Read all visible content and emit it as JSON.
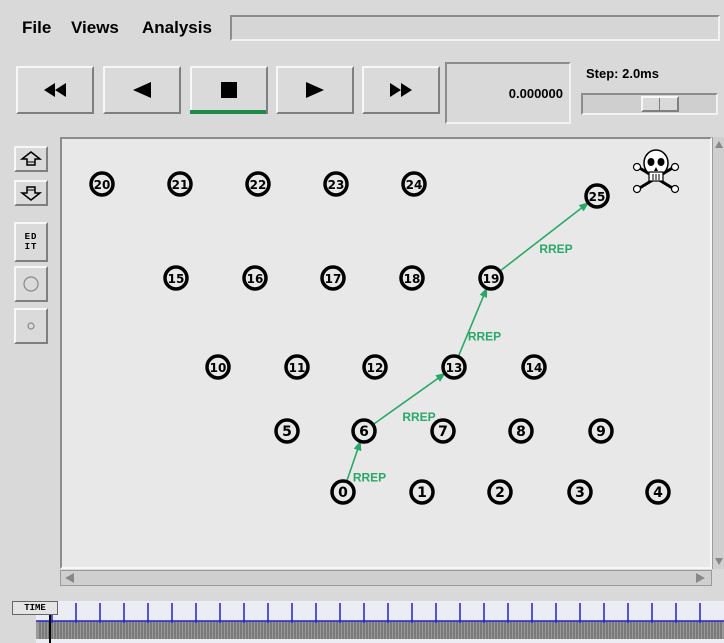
{
  "menu": {
    "file": "File",
    "views": "Views",
    "analysis": "Analysis"
  },
  "toolbar": {
    "buttons": [
      {
        "name": "rewind-button",
        "icon": "double-left-icon"
      },
      {
        "name": "step-back-button",
        "icon": "play-left-icon"
      },
      {
        "name": "stop-button",
        "icon": "stop-square-icon"
      },
      {
        "name": "play-button",
        "icon": "play-right-icon"
      },
      {
        "name": "fast-forward-button",
        "icon": "double-right-icon"
      }
    ],
    "time_display": "0.000000",
    "step_label": "Step: 2.0ms"
  },
  "sidebar": {
    "edit_label": "ED IT"
  },
  "timeline": {
    "label": "TIME"
  },
  "colors": {
    "accent_green": "#1e8a4a",
    "arrow_green": "#2aa868",
    "node_black": "#000000",
    "canvas_bg": "#e8e8e8"
  },
  "network": {
    "nodes": [
      "0",
      "1",
      "2",
      "3",
      "4",
      "5",
      "6",
      "7",
      "8",
      "9",
      "10",
      "11",
      "12",
      "13",
      "14",
      "15",
      "16",
      "17",
      "18",
      "19",
      "20",
      "21",
      "22",
      "23",
      "24",
      "25"
    ],
    "route_links": [
      {
        "from": "0",
        "to": "6",
        "label": "RREP"
      },
      {
        "from": "6",
        "to": "13",
        "label": "RREP"
      },
      {
        "from": "13",
        "to": "19",
        "label": "RREP"
      },
      {
        "from": "19",
        "to": "25",
        "label": "RREP"
      }
    ],
    "destination_marker_icon": "skull-crossbones-icon"
  }
}
